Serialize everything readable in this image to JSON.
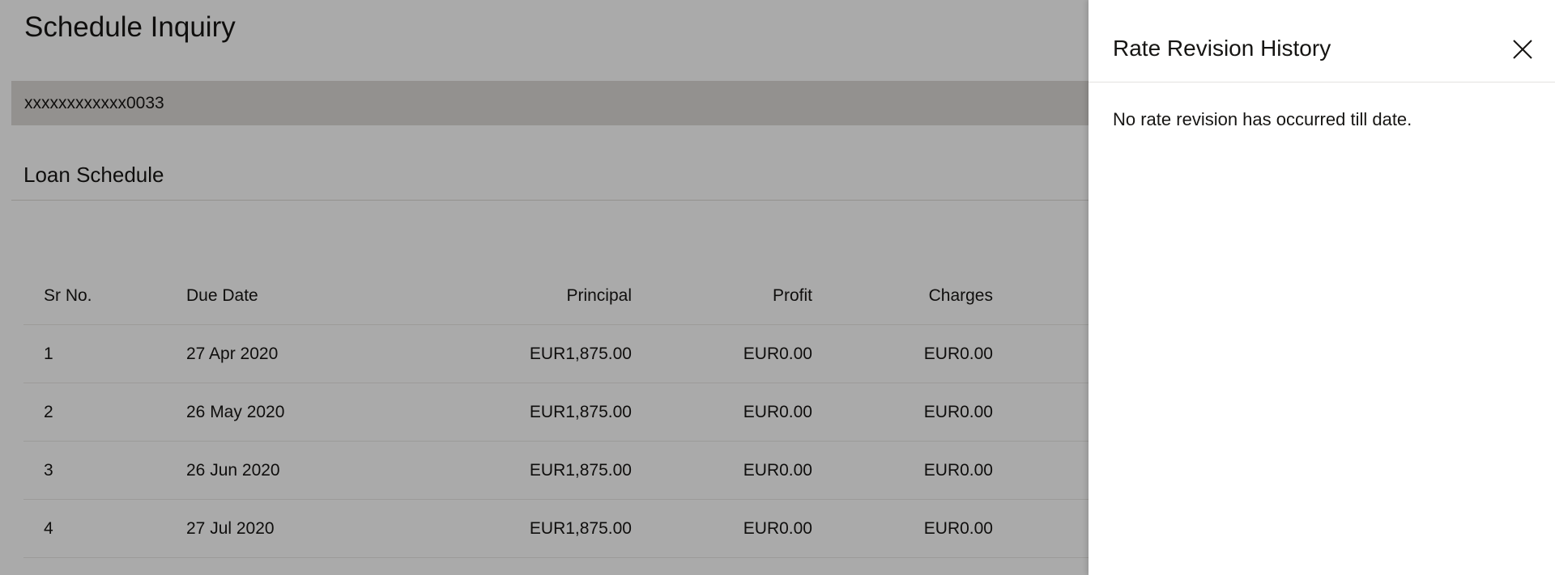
{
  "page": {
    "title": "Schedule Inquiry",
    "account_number": "xxxxxxxxxxxx0033",
    "section_title": "Loan Schedule"
  },
  "table": {
    "columns": {
      "sr": "Sr No.",
      "due_date": "Due Date",
      "principal": "Principal",
      "profit": "Profit",
      "charges": "Charges"
    },
    "rows": [
      {
        "sr": "1",
        "due_date": "27 Apr 2020",
        "principal": "EUR1,875.00",
        "profit": "EUR0.00",
        "charges": "EUR0.00"
      },
      {
        "sr": "2",
        "due_date": "26 May 2020",
        "principal": "EUR1,875.00",
        "profit": "EUR0.00",
        "charges": "EUR0.00"
      },
      {
        "sr": "3",
        "due_date": "26 Jun 2020",
        "principal": "EUR1,875.00",
        "profit": "EUR0.00",
        "charges": "EUR0.00"
      },
      {
        "sr": "4",
        "due_date": "27 Jul 2020",
        "principal": "EUR1,875.00",
        "profit": "EUR0.00",
        "charges": "EUR0.00"
      }
    ]
  },
  "drawer": {
    "title": "Rate Revision History",
    "message": "No rate revision has occurred till date.",
    "close_icon": "close-icon"
  },
  "colors": {
    "text": "#161513",
    "overlay": "rgba(0,0,0,0.315)",
    "account_bar": "#d6d3d0",
    "drawer_bg": "#ffffff"
  }
}
